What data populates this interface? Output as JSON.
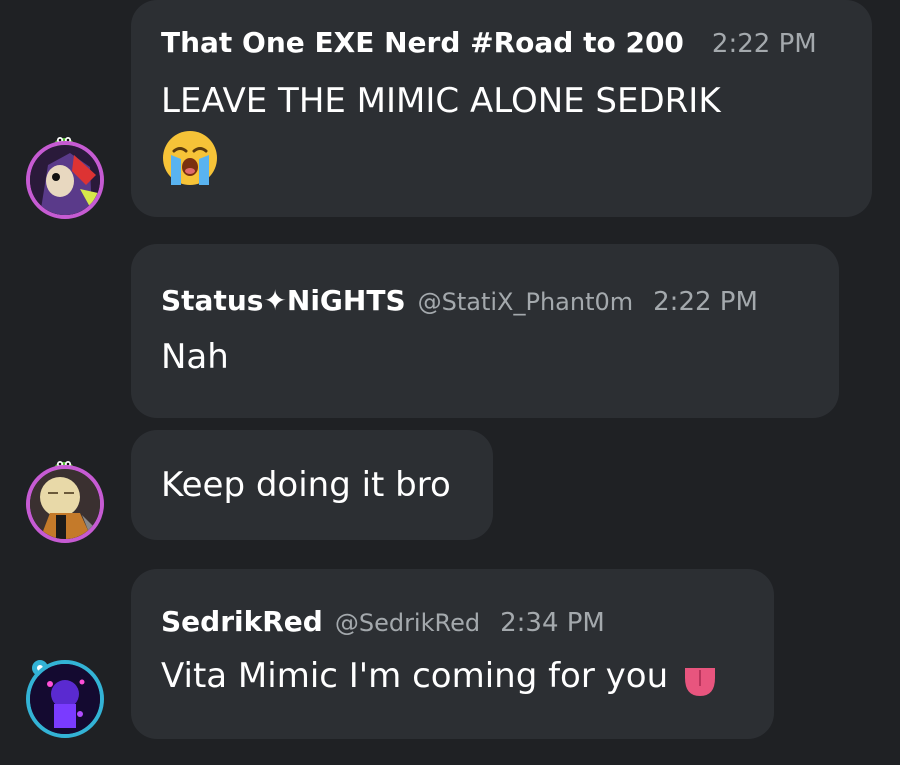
{
  "messages": [
    {
      "name": "That One EXE Nerd #Road to 200",
      "handle": "",
      "time": "2:22 PM",
      "text": "LEAVE THE MIMIC ALONE SEDRIK",
      "emoji": "crying-face-emoji",
      "avatar": "sonic-exe-avatar",
      "ring_color": "#c65bd3"
    },
    {
      "name": "Status✦NiGHTS",
      "handle": "@StatiX_Phant0m",
      "time": "2:22 PM",
      "text": "Nah",
      "avatar": "none"
    },
    {
      "text": "Keep doing it bro",
      "avatar": "character-avatar",
      "ring_color": "#c65bd3"
    },
    {
      "name": "SedrikRed",
      "handle": "@SedrikRed",
      "time": "2:34 PM",
      "text": "Vita Mimic I'm coming for you",
      "emoji": "tongue-out-emoji",
      "avatar": "purple-scene-avatar",
      "ring_color": "#33b3d6"
    }
  ],
  "colors": {
    "background": "#1f2124",
    "bubble": "#2c2f33",
    "text": "#ffffff",
    "meta": "#a4a9ad"
  }
}
